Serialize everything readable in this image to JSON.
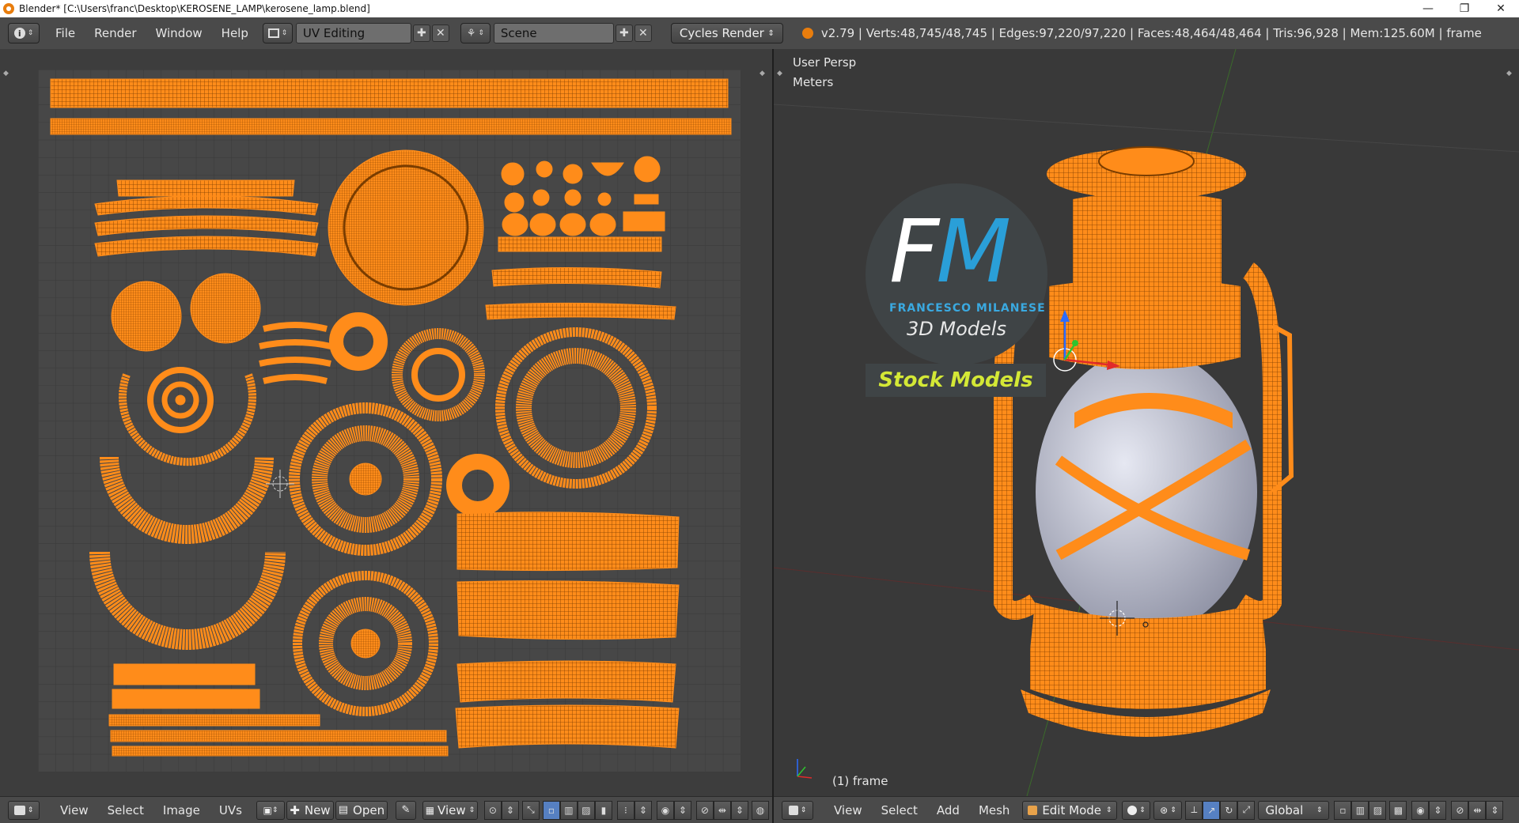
{
  "window": {
    "title": "Blender* [C:\\Users\\franc\\Desktop\\KEROSENE_LAMP\\kerosene_lamp.blend]",
    "minimize": "—",
    "restore": "❐",
    "close": "✕"
  },
  "topbar": {
    "menus": [
      "File",
      "Render",
      "Window",
      "Help"
    ],
    "layout_name": "UV Editing",
    "scene_name": "Scene",
    "render_engine": "Cycles Render",
    "stats": "v2.79 | Verts:48,745/48,745 | Edges:97,220/97,220 | Faces:48,464/48,464 | Tris:96,928 | Mem:125.60M | frame"
  },
  "viewport": {
    "persp_label": "User Persp",
    "units_label": "Meters",
    "object_label": "(1) frame"
  },
  "watermark": {
    "letter_f": "F",
    "letter_m": "M",
    "name": "FRANCESCO MILANESE",
    "sub": "3D Models",
    "badge": "Stock Models"
  },
  "uv_footer": {
    "view": "View",
    "select": "Select",
    "image": "Image",
    "uvs": "UVs",
    "new": "New",
    "open": "Open",
    "view2": "View"
  },
  "view3d_footer": {
    "view": "View",
    "select": "Select",
    "add": "Add",
    "mesh": "Mesh",
    "mode": "Edit Mode",
    "orientation": "Global"
  },
  "colors": {
    "uv_orange": "#ff8c1a",
    "axis_blue": "#2b6cff",
    "axis_red": "#e02a2a",
    "axis_green": "#2fc42f"
  }
}
